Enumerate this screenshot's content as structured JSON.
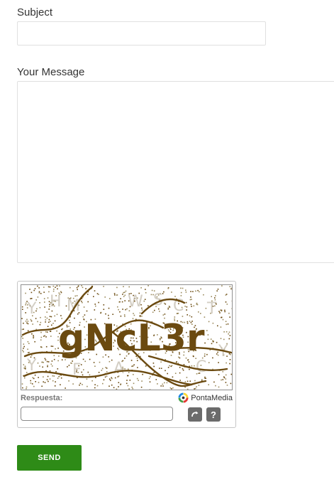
{
  "form": {
    "subject_label": "Subject",
    "subject_value": "",
    "message_label": "Your Message",
    "message_value": "",
    "send_label": "SEND"
  },
  "captcha": {
    "text": "gNcL3r",
    "answer_label": "Respuesta:",
    "answer_value": "",
    "brand_part1": "Ponta",
    "brand_part2": "Media",
    "refresh_icon": "refresh-icon",
    "help_label": "?",
    "ink_color": "#6b4a10",
    "button_color": "#6b6b6b"
  },
  "colors": {
    "send_button": "#2e8b17",
    "label_text": "#333333"
  }
}
